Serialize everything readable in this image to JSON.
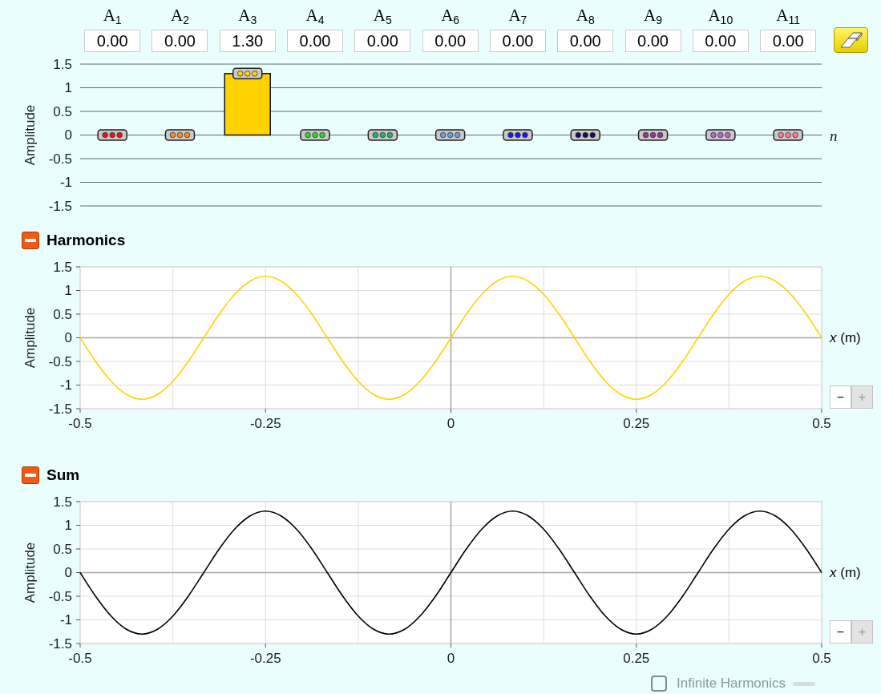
{
  "amplitudes": {
    "harmonics": [
      {
        "label": "A$_{1}$",
        "value": "0.00",
        "level": 0.5,
        "color": "#ee1111"
      },
      {
        "label": "A$_{2}$",
        "value": "0.00",
        "level": 0.5,
        "color": "#ff8c1a"
      },
      {
        "label": "A$_{3}$",
        "value": "1.30",
        "level": 0.9333,
        "color": "#ffd200"
      },
      {
        "label": "A$_{4}$",
        "value": "0.00",
        "level": 0.5,
        "color": "#22dd22"
      },
      {
        "label": "A$_{5}$",
        "value": "0.00",
        "level": 0.5,
        "color": "#22b36b"
      },
      {
        "label": "A$_{6}$",
        "value": "0.00",
        "level": 0.5,
        "color": "#6f9be6"
      },
      {
        "label": "A$_{7}$",
        "value": "0.00",
        "level": 0.5,
        "color": "#1a1aee"
      },
      {
        "label": "A$_{8}$",
        "value": "0.00",
        "level": 0.5,
        "color": "#10105e"
      },
      {
        "label": "A$_{9}$",
        "value": "0.00",
        "level": 0.5,
        "color": "#993399"
      },
      {
        "label": "A$_{10}$",
        "value": "0.00",
        "level": 0.5,
        "color": "#bb66cc"
      },
      {
        "label": "A$_{11}$",
        "value": "0.00",
        "level": 0.5,
        "color": "#ff7799"
      }
    ],
    "yticks": [
      "1.5",
      "1",
      "0.5",
      "0",
      "-0.5",
      "-1",
      "-1.5"
    ],
    "ylabel": "Amplitude",
    "xlabel": "n"
  },
  "harmonics_panel": {
    "title": "Harmonics",
    "expanded": true,
    "chart_data": {
      "type": "line",
      "xlabel": "*x* (m)",
      "ylabel": "Amplitude",
      "x": [
        -0.5,
        -0.4792,
        -0.4583,
        -0.4375,
        -0.4167,
        -0.3958,
        -0.375,
        -0.3542,
        -0.3333,
        -0.3125,
        -0.2917,
        -0.2708,
        -0.25,
        -0.2292,
        -0.2083,
        -0.1875,
        -0.1667,
        -0.1458,
        -0.125,
        -0.1042,
        -0.0833,
        -0.0625,
        -0.0417,
        -0.0208,
        0,
        0.0208,
        0.0417,
        0.0625,
        0.0833,
        0.1042,
        0.125,
        0.1458,
        0.1667,
        0.1875,
        0.2083,
        0.2292,
        0.25,
        0.2708,
        0.2917,
        0.3125,
        0.3333,
        0.3542,
        0.375,
        0.3958,
        0.4167,
        0.4375,
        0.4583,
        0.4792,
        0.5
      ],
      "series": [
        {
          "color": "#ffd200",
          "values": [
            0,
            -0.5,
            -0.92,
            -1.2,
            -1.3,
            -1.2,
            -0.92,
            -0.5,
            0,
            0.5,
            0.92,
            1.2,
            1.3,
            1.2,
            0.92,
            0.5,
            0,
            -0.5,
            -0.92,
            -1.2,
            -1.3,
            -1.2,
            -0.92,
            -0.5,
            0,
            0.5,
            0.92,
            1.2,
            1.3,
            1.2,
            0.92,
            0.5,
            0,
            -0.5,
            -0.92,
            -1.2,
            -1.3,
            -1.2,
            -0.92,
            -0.5,
            0,
            0.5,
            0.92,
            1.2,
            1.3,
            1.2,
            0.92,
            0.5,
            0
          ]
        }
      ],
      "xlim": [
        -0.5,
        0.5
      ],
      "ylim": [
        -1.5,
        1.5
      ],
      "xticks": [
        -0.5,
        -0.25,
        0,
        0.25,
        0.5
      ],
      "yticks": [
        -1.5,
        -1,
        -0.5,
        0,
        0.5,
        1,
        1.5
      ],
      "grid": true
    },
    "zoom_buttons": [
      {
        "label": "−",
        "disabled": false
      },
      {
        "label": "+",
        "disabled": true
      }
    ]
  },
  "sum_panel": {
    "title": "Sum",
    "expanded": true,
    "chart_data": {
      "type": "line",
      "xlabel": "*x* (m)",
      "ylabel": "Amplitude",
      "x": [
        -0.5,
        -0.4792,
        -0.4583,
        -0.4375,
        -0.4167,
        -0.3958,
        -0.375,
        -0.3542,
        -0.3333,
        -0.3125,
        -0.2917,
        -0.2708,
        -0.25,
        -0.2292,
        -0.2083,
        -0.1875,
        -0.1667,
        -0.1458,
        -0.125,
        -0.1042,
        -0.0833,
        -0.0625,
        -0.0417,
        -0.0208,
        0,
        0.0208,
        0.0417,
        0.0625,
        0.0833,
        0.1042,
        0.125,
        0.1458,
        0.1667,
        0.1875,
        0.2083,
        0.2292,
        0.25,
        0.2708,
        0.2917,
        0.3125,
        0.3333,
        0.3542,
        0.375,
        0.3958,
        0.4167,
        0.4375,
        0.4583,
        0.4792,
        0.5
      ],
      "series": [
        {
          "color": "#000000",
          "values": [
            0,
            -0.5,
            -0.92,
            -1.2,
            -1.3,
            -1.2,
            -0.92,
            -0.5,
            0,
            0.5,
            0.92,
            1.2,
            1.3,
            1.2,
            0.92,
            0.5,
            0,
            -0.5,
            -0.92,
            -1.2,
            -1.3,
            -1.2,
            -0.92,
            -0.5,
            0,
            0.5,
            0.92,
            1.2,
            1.3,
            1.2,
            0.92,
            0.5,
            0,
            -0.5,
            -0.92,
            -1.2,
            -1.3,
            -1.2,
            -0.92,
            -0.5,
            0,
            0.5,
            0.92,
            1.2,
            1.3,
            1.2,
            0.92,
            0.5,
            0
          ]
        }
      ],
      "xlim": [
        -0.5,
        0.5
      ],
      "ylim": [
        -1.5,
        1.5
      ],
      "xticks": [
        -0.5,
        -0.25,
        0,
        0.25,
        0.5
      ],
      "yticks": [
        -1.5,
        -1,
        -0.5,
        0,
        0.5,
        1,
        1.5
      ],
      "grid": true
    },
    "zoom_buttons": [
      {
        "label": "−",
        "disabled": false
      },
      {
        "label": "+",
        "disabled": true
      }
    ]
  },
  "infinite_harmonics": {
    "label": "Infinite Harmonics",
    "checked": false,
    "disabled": true
  }
}
